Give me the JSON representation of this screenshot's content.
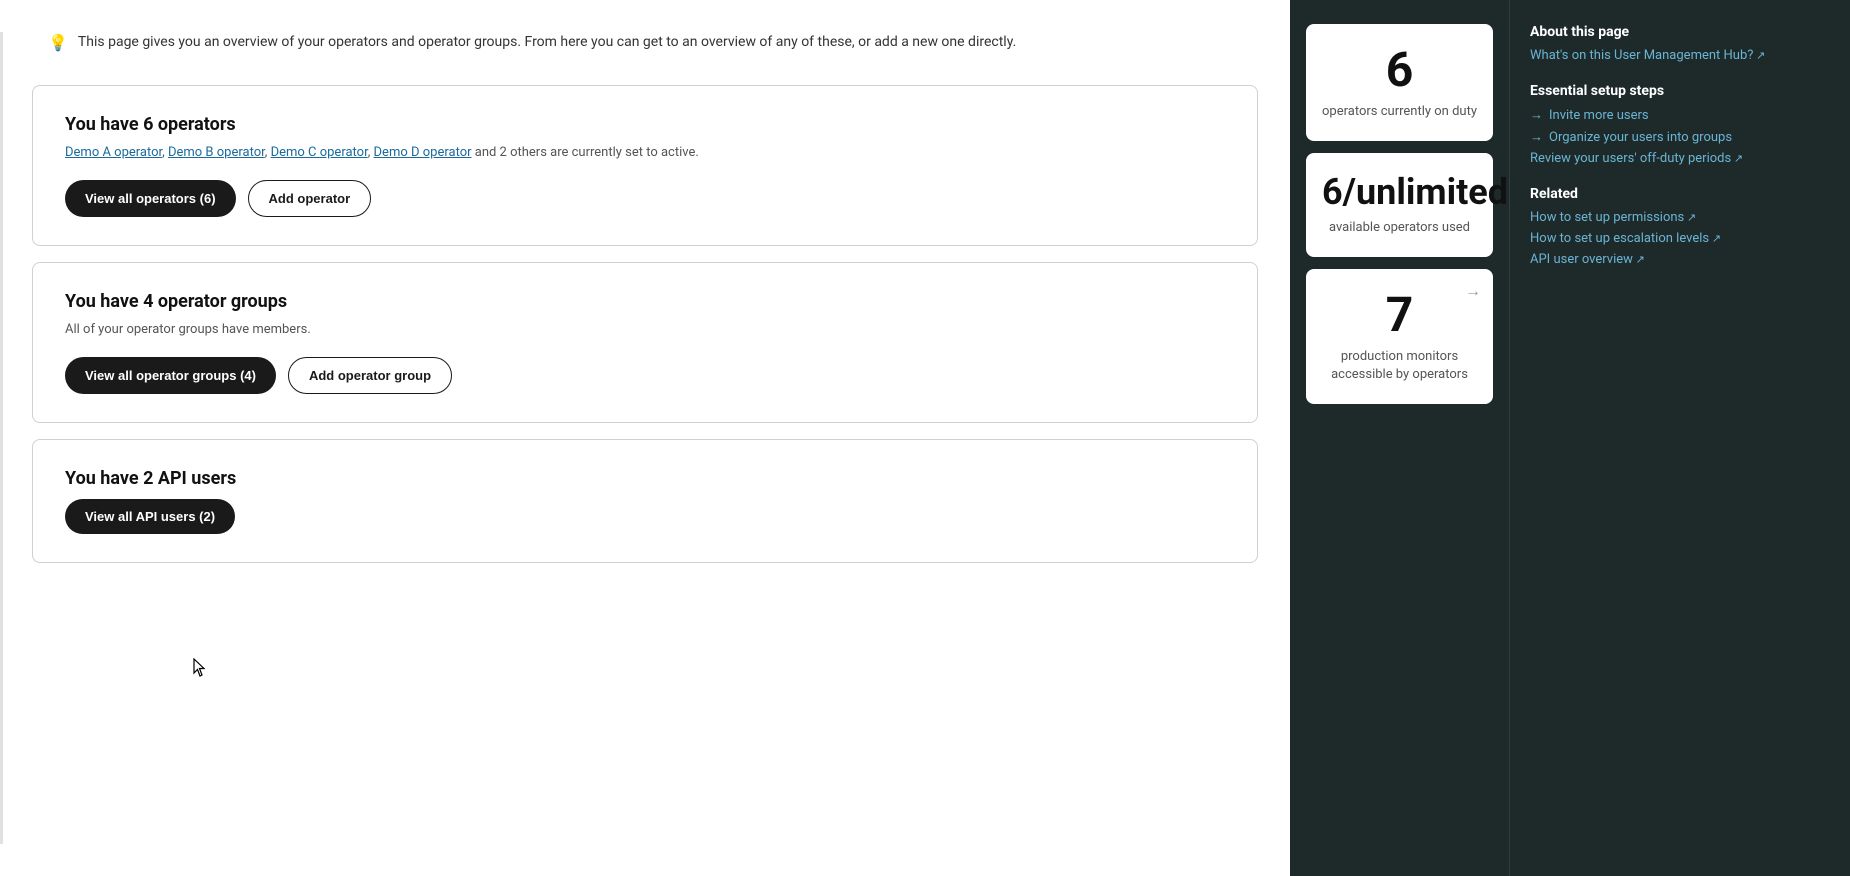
{
  "info_banner": {
    "icon": "💡",
    "text": "This page gives you an overview of your operators and operator groups. From here you can get to an overview of any of these, or add a new one directly."
  },
  "cards": [
    {
      "id": "operators",
      "title": "You have 6 operators",
      "description_links": "Demo A operator, Demo B operator, Demo C operator, Demo D operator and 2 others are currently set to active.",
      "links": [
        {
          "text": "Demo A operator",
          "href": "#"
        },
        {
          "text": "Demo B operator",
          "href": "#"
        },
        {
          "text": "Demo C operator",
          "href": "#"
        },
        {
          "text": "Demo D operator",
          "href": "#"
        }
      ],
      "suffix_text": " and 2 others are currently set to active.",
      "actions": [
        {
          "label": "View all operators (6)",
          "style": "dark"
        },
        {
          "label": "Add operator",
          "style": "outline"
        }
      ]
    },
    {
      "id": "operator-groups",
      "title": "You have 4 operator groups",
      "description": "All of your operator groups have members.",
      "actions": [
        {
          "label": "View all operator groups (4)",
          "style": "dark"
        },
        {
          "label": "Add operator group",
          "style": "outline"
        }
      ]
    },
    {
      "id": "api-users",
      "title": "You have 2 API users",
      "description": "",
      "actions": [
        {
          "label": "View all API users (2)",
          "style": "dark"
        }
      ]
    }
  ],
  "stats": [
    {
      "id": "on-duty",
      "number": "6",
      "number_type": "integer",
      "label": "operators currently on duty",
      "has_arrow": false
    },
    {
      "id": "available",
      "number": "6/unlimited",
      "number_type": "fraction",
      "label": "available operators used",
      "has_arrow": false
    },
    {
      "id": "monitors",
      "number": "7",
      "number_type": "integer",
      "label": "production monitors accessible by operators",
      "has_arrow": true
    }
  ],
  "sidebar": {
    "about_title": "About this page",
    "about_link": "What's on this User Management Hub?",
    "essential_title": "Essential setup steps",
    "essential_links": [
      {
        "text": "Invite more users"
      },
      {
        "text": "Organize your users into groups"
      }
    ],
    "review_link": "Review your users' off-duty periods",
    "related_title": "Related",
    "related_links": [
      {
        "text": "How to set up permissions"
      },
      {
        "text": "How to set up escalation levels"
      },
      {
        "text": "API user overview"
      }
    ]
  }
}
